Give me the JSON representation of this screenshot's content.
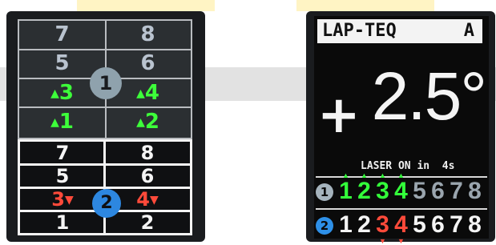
{
  "left_display": {
    "sensor1": {
      "badge": "1",
      "rows": [
        {
          "left": "7",
          "right": "8"
        },
        {
          "left": "5",
          "right": "6"
        },
        {
          "left": "3",
          "right": "4"
        },
        {
          "left": "1",
          "right": "2"
        }
      ]
    },
    "sensor2": {
      "badge": "2",
      "rows": [
        {
          "left": "7",
          "right": "8"
        },
        {
          "left": "5",
          "right": "6"
        },
        {
          "left": "3",
          "right": "4"
        },
        {
          "left": "1",
          "right": "2"
        }
      ]
    },
    "up_marker": "▲",
    "down_marker": "▼"
  },
  "right_display": {
    "brand": "LAP-TEQ",
    "mode": "A",
    "sign": "+",
    "angle": "2.5°",
    "laser_status": "LASER ON in  4s",
    "sensor1": {
      "badge": "1",
      "digits": [
        "1",
        "2",
        "3",
        "4",
        "5",
        "6",
        "7",
        "8"
      ]
    },
    "sensor2": {
      "badge": "2",
      "digits": [
        "1",
        "2",
        "3",
        "4",
        "5",
        "6",
        "7",
        "8"
      ]
    }
  },
  "colors": {
    "active_up": "#3dff3a",
    "active_down": "#ff4a3a",
    "sensor1_badge": "#8fa2ad",
    "sensor2_badge": "#2d87e0"
  }
}
